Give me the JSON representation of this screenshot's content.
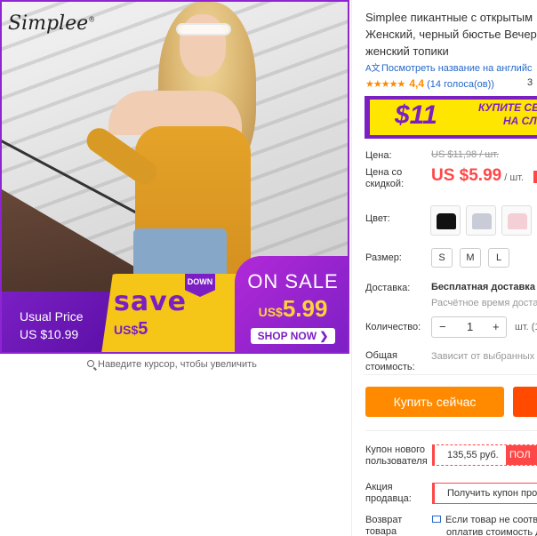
{
  "image": {
    "logo": "Simplee",
    "logo_mark": "®",
    "banner": {
      "usual_label": "Usual Price",
      "usual_price": "US $10.99",
      "save_word": "save",
      "save_currency": "US$",
      "save_amount": "5",
      "down_tag": "DOWN",
      "sale_title": "ON SALE",
      "sale_currency": "US$",
      "sale_price": "5.99",
      "shop_now": "SHOP NOW ❯"
    },
    "zoom_hint": "Наведите курсор, чтобы увеличить"
  },
  "product": {
    "title_lines": [
      "Simplee пикантные с открытым",
      "Женский, черный бюстье Вечер",
      "женский топики"
    ],
    "translate_link": "Посмотреть название на английс",
    "translate_icon": "translate-icon",
    "rating": {
      "stars": "★★★★★",
      "value": "4,4",
      "count": "(14 голоса(ов))",
      "tail": "3"
    },
    "promo": {
      "amount": "$11",
      "text_line1": "КУПИТЕ СЕ",
      "text_line2": "НА СЛ"
    },
    "price": {
      "label": "Цена:",
      "old": "US $11,98 / шт.",
      "discount_label": "Цена со скидкой:",
      "new": "US $5.99",
      "unit": "/ шт."
    },
    "color": {
      "label": "Цвет:",
      "swatches": [
        "black",
        "gray",
        "pink"
      ]
    },
    "size": {
      "label": "Размер:",
      "options": [
        "S",
        "M",
        "L"
      ]
    },
    "shipping": {
      "label": "Доставка:",
      "main": "Бесплатная доставка в",
      "sub": "Расчётное время доставк"
    },
    "quantity": {
      "label": "Количество:",
      "minus": "−",
      "value": "1",
      "plus": "+",
      "unit": "шт. (1"
    },
    "total": {
      "label": "Общая стоимость:",
      "value": "Зависит от выбранных за"
    },
    "buy_now": "Купить сейчас",
    "coupon": {
      "label": "Купон нового пользователя",
      "value": "135,55 руб.",
      "badge": "ПОЛ"
    },
    "seller_promo": {
      "label": "Акция продавца:",
      "value": "Получить купон продав"
    },
    "return": {
      "label": "Возврат товара",
      "line1": "Если товар не соответ",
      "line2": "оплатив стоимость до"
    }
  },
  "colors": {
    "accent_purple": "#7b1fc4",
    "price_red": "#ff4747",
    "buy_orange": "#ff8a00",
    "link_blue": "#2468c9",
    "promo_yellow": "#ffe600"
  }
}
